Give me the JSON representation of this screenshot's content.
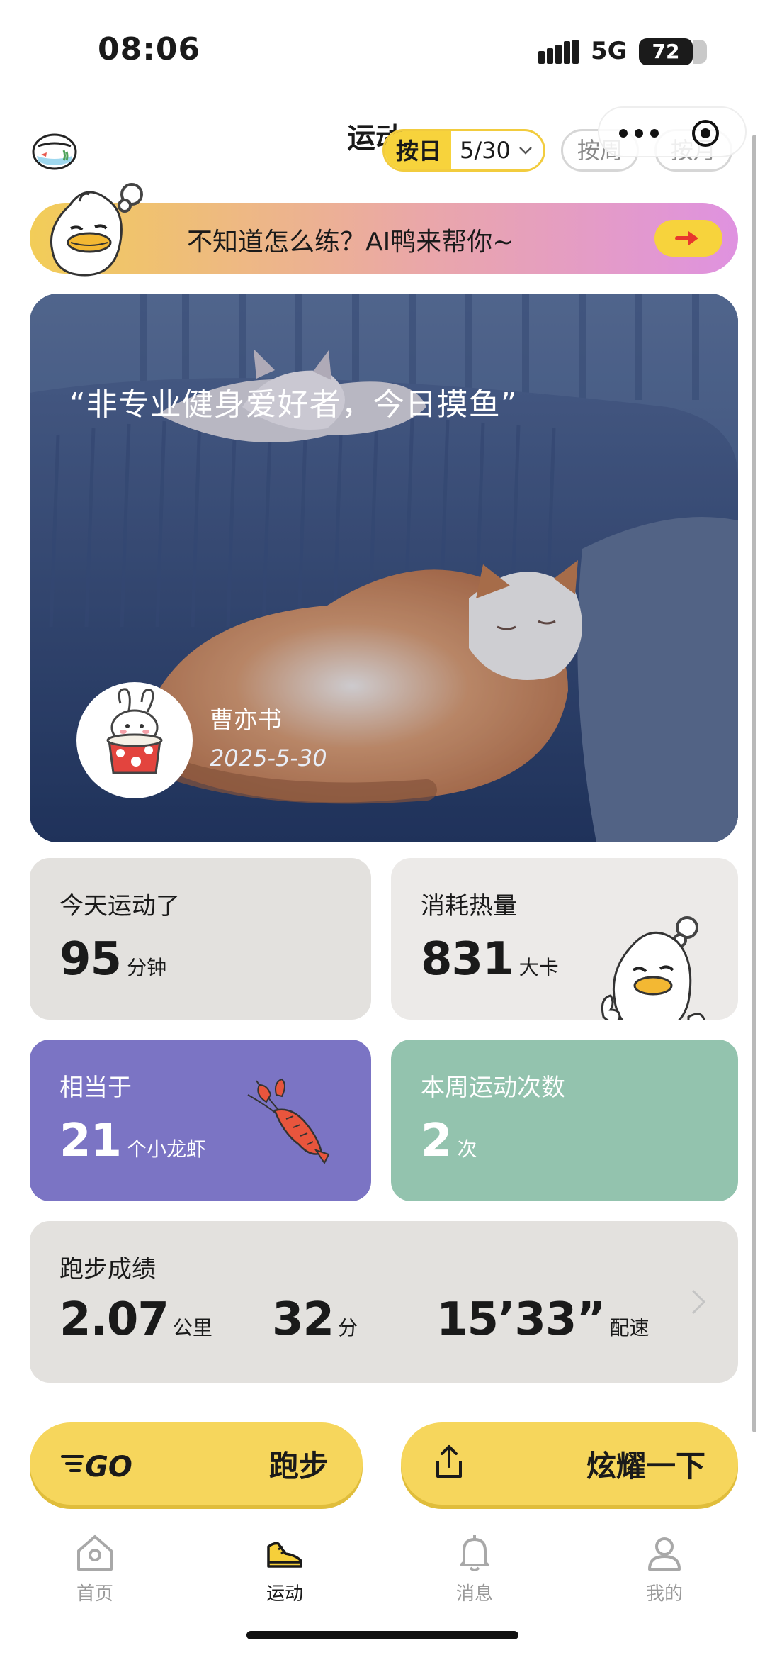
{
  "status": {
    "time": "08:06",
    "network": "5G",
    "battery": "72"
  },
  "header": {
    "title": "运动",
    "mode_day_label": "按日",
    "selected_date": "5/30",
    "mode_week_label": "按周",
    "mode_month_label": "按月"
  },
  "ai_banner": {
    "text": "不知道怎么练？AI鸭来帮你~"
  },
  "hero": {
    "quote": "“非专业健身爱好者，今日摸鱼”",
    "user_name": "曹亦书",
    "date": "2025-5-30"
  },
  "stats": {
    "today": {
      "label": "今天运动了",
      "value": "95",
      "unit": "分钟"
    },
    "calories": {
      "label": "消耗热量",
      "value": "831",
      "unit": "大卡"
    },
    "equivalent": {
      "label": "相当于",
      "value": "21",
      "unit": "个小龙虾"
    },
    "week": {
      "label": "本周运动次数",
      "value": "2",
      "unit": "次"
    }
  },
  "running": {
    "label": "跑步成绩",
    "distance_value": "2.07",
    "distance_unit": "公里",
    "time_value": "32",
    "time_unit": "分",
    "pace_value": "15’33”",
    "pace_unit": "配速"
  },
  "actions": {
    "run_label": "跑步",
    "share_label": "炫耀一下"
  },
  "tabbar": {
    "items": [
      {
        "label": "首页",
        "icon": "home-icon"
      },
      {
        "label": "运动",
        "icon": "sneaker-icon"
      },
      {
        "label": "消息",
        "icon": "bell-icon"
      },
      {
        "label": "我的",
        "icon": "profile-icon"
      }
    ],
    "active": "运动"
  },
  "colors": {
    "accent_yellow": "#f6d65c",
    "purple_card": "#7b74c4",
    "green_card": "#93c3ae",
    "gray_card": "#e3e1de"
  }
}
